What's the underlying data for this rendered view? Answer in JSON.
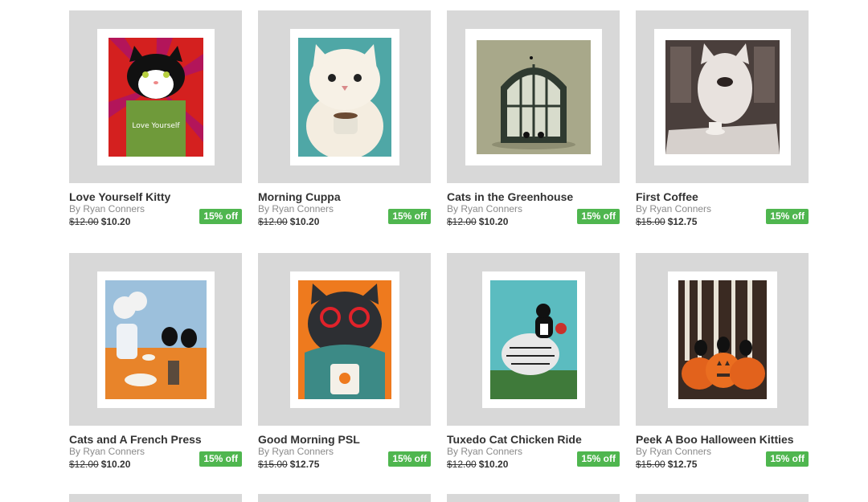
{
  "products": [
    {
      "title": "Love Yourself Kitty",
      "artist": "By Ryan Conners",
      "old_price": "$12.00",
      "price": "$10.20",
      "badge": "15% off",
      "art_text": "Love Yourself"
    },
    {
      "title": "Morning Cuppa",
      "artist": "By Ryan Conners",
      "old_price": "$12.00",
      "price": "$10.20",
      "badge": "15% off"
    },
    {
      "title": "Cats in the Greenhouse",
      "artist": "By Ryan Conners",
      "old_price": "$12.00",
      "price": "$10.20",
      "badge": "15% off"
    },
    {
      "title": "First Coffee",
      "artist": "By Ryan Conners",
      "old_price": "$15.00",
      "price": "$12.75",
      "badge": "15% off"
    },
    {
      "title": "Cats and A French Press",
      "artist": "By Ryan Conners",
      "old_price": "$12.00",
      "price": "$10.20",
      "badge": "15% off"
    },
    {
      "title": "Good Morning PSL",
      "artist": "By Ryan Conners",
      "old_price": "$15.00",
      "price": "$12.75",
      "badge": "15% off"
    },
    {
      "title": "Tuxedo Cat Chicken Ride",
      "artist": "By Ryan Conners",
      "old_price": "$12.00",
      "price": "$10.20",
      "badge": "15% off"
    },
    {
      "title": "Peek A Boo Halloween Kitties",
      "artist": "By Ryan Conners",
      "old_price": "$15.00",
      "price": "$12.75",
      "badge": "15% off"
    }
  ]
}
